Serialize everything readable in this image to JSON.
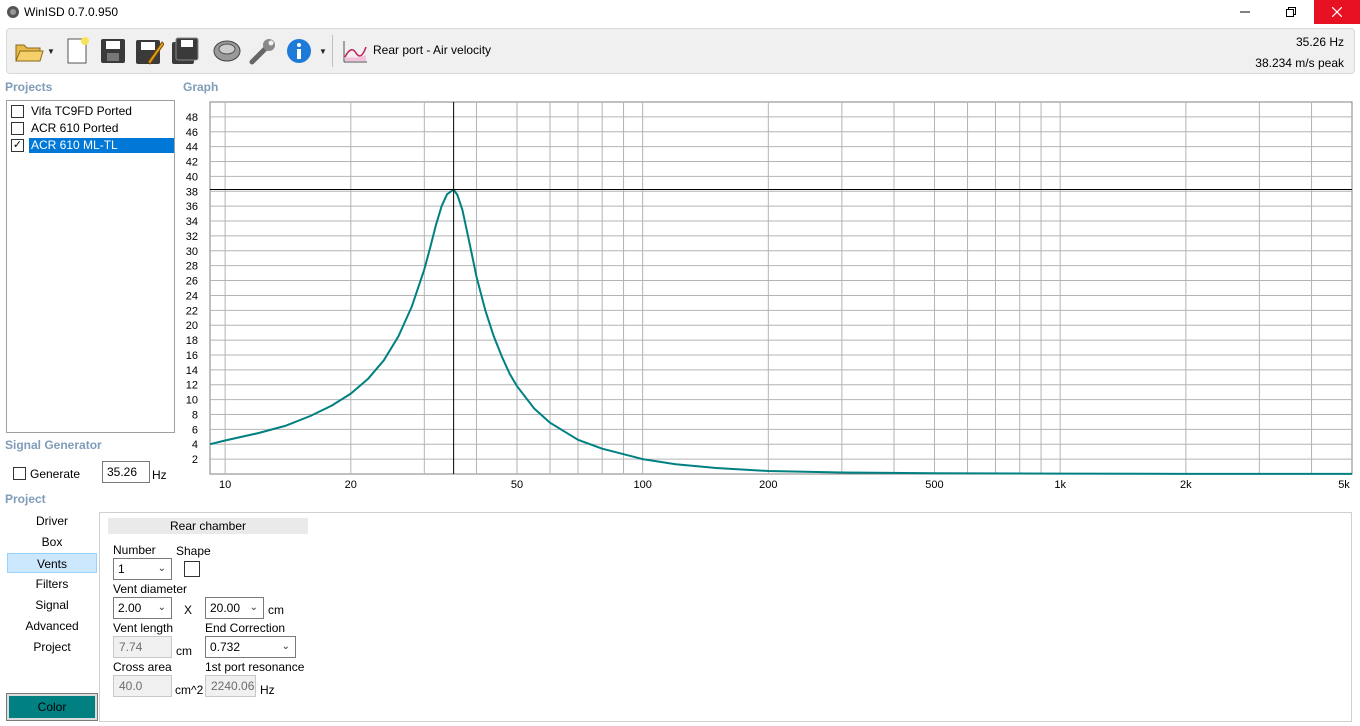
{
  "window": {
    "title": "WinISD 0.7.0.950",
    "minimize_icon": "minimize-icon",
    "maximize_icon": "restore-icon",
    "close_icon": "close-icon"
  },
  "toolbar": {
    "graph_select": "Rear port - Air velocity",
    "readout_frequency": "35.26 Hz",
    "readout_value": "38.234 m/s peak",
    "icons": [
      "open-folder-icon",
      "new-document-icon",
      "save-icon",
      "save-as-icon",
      "save-all-icon",
      "driver-speaker-icon",
      "wrench-icon",
      "info-icon",
      "graph-icon"
    ]
  },
  "projects": {
    "label": "Projects",
    "items": [
      {
        "name": "Vifa TC9FD Ported",
        "checked": false,
        "selected": false
      },
      {
        "name": "ACR 610 Ported",
        "checked": false,
        "selected": false
      },
      {
        "name": "ACR 610 ML-TL",
        "checked": true,
        "selected": true
      }
    ]
  },
  "graph": {
    "label": "Graph"
  },
  "signal_generator": {
    "label": "Signal Generator",
    "generate_label": "Generate",
    "generate_checked": false,
    "frequency": "35.26",
    "unit": "Hz"
  },
  "project_nav": {
    "label": "Project",
    "items": [
      "Driver",
      "Box",
      "Vents",
      "Filters",
      "Signal",
      "Advanced",
      "Project"
    ],
    "active": "Vents",
    "color_button": "Color"
  },
  "vents": {
    "header": "Rear chamber",
    "number_label": "Number",
    "number_value": "1",
    "shape_label": "Shape",
    "diameter_label": "Vent diameter",
    "diameter_value": "2.00",
    "times": "X",
    "diameter2_value": "20.00",
    "diameter_unit": "cm",
    "length_label": "Vent length",
    "length_value": "7.74",
    "length_unit": "cm",
    "end_correction_label": "End Correction",
    "end_correction_value": "0.732",
    "cross_area_label": "Cross area",
    "cross_area_value": "40.0",
    "cross_area_unit": "cm^2",
    "port_resonance_label": "1st port resonance",
    "port_resonance_value": "2240.06",
    "port_resonance_unit": "Hz"
  },
  "chart_data": {
    "type": "line",
    "xscale": "log",
    "xlim": [
      9.2,
      5000
    ],
    "ylim": [
      0,
      50
    ],
    "xticks": [
      "10",
      "20",
      "50",
      "100",
      "200",
      "500",
      "1k",
      "2k",
      "5k"
    ],
    "xtick_values": [
      10,
      20,
      50,
      100,
      200,
      500,
      1000,
      2000,
      5000
    ],
    "yticks": [
      2,
      4,
      6,
      8,
      10,
      12,
      14,
      16,
      18,
      20,
      22,
      24,
      26,
      28,
      30,
      32,
      34,
      36,
      38,
      40,
      42,
      44,
      46,
      48
    ],
    "grid": true,
    "line_color": "#008080",
    "cursor": {
      "x": 35.26,
      "y": 38.234
    },
    "series": [
      {
        "x": [
          9.2,
          10,
          12,
          14,
          16,
          18,
          20,
          22,
          24,
          26,
          28,
          30,
          31,
          32,
          33,
          34,
          35.26,
          36,
          37,
          38,
          39,
          40,
          42,
          44,
          46,
          48,
          50,
          55,
          60,
          70,
          80,
          100,
          120,
          150,
          200,
          300,
          500,
          1000,
          2000,
          5000
        ],
        "y": [
          4.0,
          4.5,
          5.5,
          6.5,
          7.8,
          9.2,
          10.8,
          12.8,
          15.3,
          18.5,
          22.5,
          27.5,
          30.5,
          33.5,
          36.0,
          37.6,
          38.234,
          37.5,
          35.5,
          32.5,
          29.5,
          26.5,
          22.0,
          18.5,
          15.8,
          13.5,
          11.8,
          8.8,
          6.9,
          4.6,
          3.4,
          2.0,
          1.3,
          0.8,
          0.4,
          0.2,
          0.1,
          0.05,
          0.02,
          0.01
        ]
      }
    ]
  }
}
